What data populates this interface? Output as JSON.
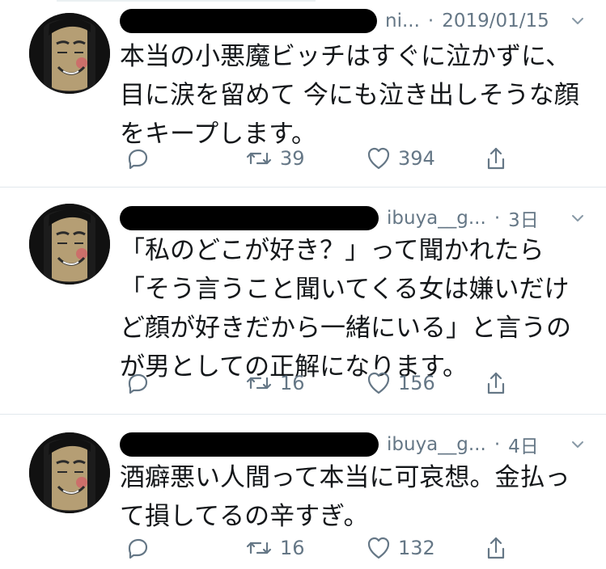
{
  "tweets": [
    {
      "handle_fragment": "ni...",
      "separator": "·",
      "timestamp": "2019/01/15",
      "text": "本当の小悪魔ビッチはすぐに泣かずに、目に涙を留めて 今にも泣き出しそうな顔をキープします。",
      "retweets": "39",
      "likes": "394",
      "icons": {
        "reply": "reply-icon",
        "retweet": "retweet-icon",
        "like": "heart-icon",
        "share": "share-icon",
        "menu": "chevron-down-icon"
      }
    },
    {
      "handle_fragment": "ibuya__g...",
      "separator": "·",
      "timestamp": "3日",
      "text": "「私のどこが好き？」って聞かれたら「そう言うこと聞いてくる女は嫌いだけど顔が好きだから一緒にいる」と言うのが男としての正解になります。",
      "retweets": "16",
      "likes": "156",
      "icons": {
        "reply": "reply-icon",
        "retweet": "retweet-icon",
        "like": "heart-icon",
        "share": "share-icon",
        "menu": "chevron-down-icon"
      }
    },
    {
      "handle_fragment": "ibuya__g...",
      "separator": "·",
      "timestamp": "4日",
      "text": "酒癖悪い人間って本当に可哀想。金払って損してるの辛すぎ。",
      "retweets": "16",
      "likes": "132",
      "icons": {
        "reply": "reply-icon",
        "retweet": "retweet-icon",
        "like": "heart-icon",
        "share": "share-icon",
        "menu": "chevron-down-icon"
      }
    }
  ],
  "colors": {
    "text": "#14171a",
    "muted": "#657786",
    "divider": "#e1e8ed",
    "redaction": "#000000"
  }
}
